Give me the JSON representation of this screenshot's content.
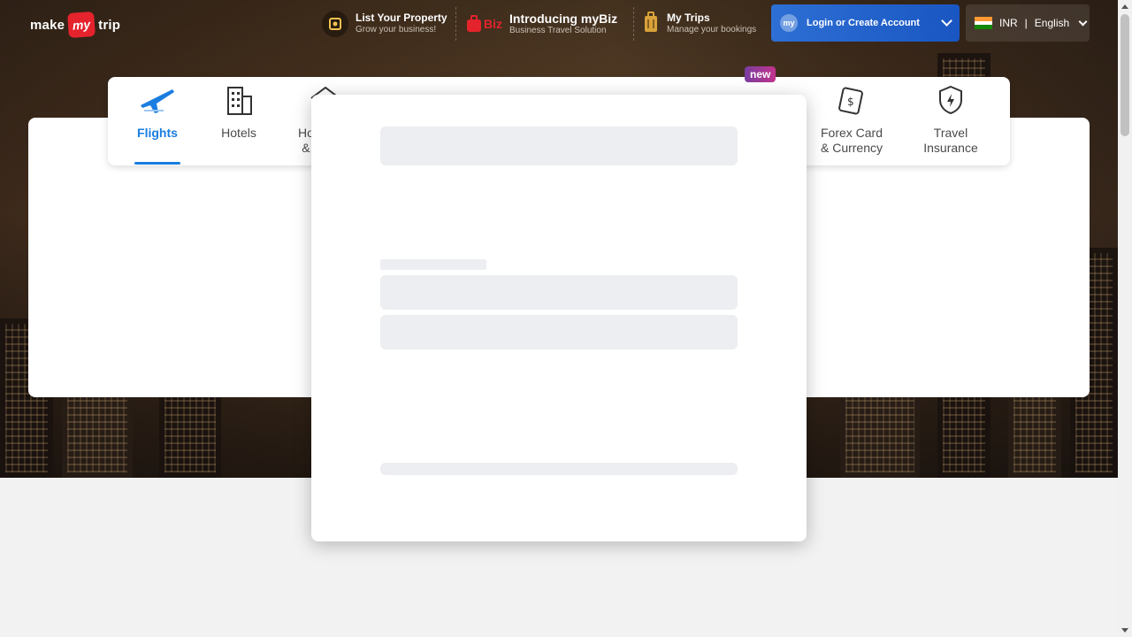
{
  "header": {
    "logo": {
      "left": "make",
      "mid": "my",
      "right": "trip"
    },
    "list_property": {
      "title": "List Your Property",
      "subtitle": "Grow your business!"
    },
    "mybiz": {
      "badge": "Biz",
      "title": "Introducing myBiz",
      "subtitle": "Business Travel Solution"
    },
    "my_trips": {
      "title": "My Trips",
      "subtitle": "Manage your bookings"
    },
    "login": {
      "label": "Login or Create Account",
      "avatar_text": "my"
    },
    "locale": {
      "currency": "INR",
      "language": "English"
    }
  },
  "nav": {
    "items": [
      {
        "label": "Flights",
        "icon": "airplane-icon",
        "active": true
      },
      {
        "label": "Hotels",
        "icon": "hotel-building-icon",
        "active": false
      },
      {
        "label": "Ho\n&",
        "icon": "homestay-icon",
        "active": false
      },
      {
        "label": "Forex Card\n& Currency",
        "icon": "forex-card-icon",
        "active": false
      },
      {
        "label": "Travel\nInsurance",
        "icon": "insurance-shield-icon",
        "active": false
      }
    ],
    "new_badge": "new"
  },
  "colors": {
    "accent": "#1a7de0",
    "login_bg": "#1f5fca",
    "brand_red": "#e4232d",
    "skeleton": "#eceef1"
  }
}
